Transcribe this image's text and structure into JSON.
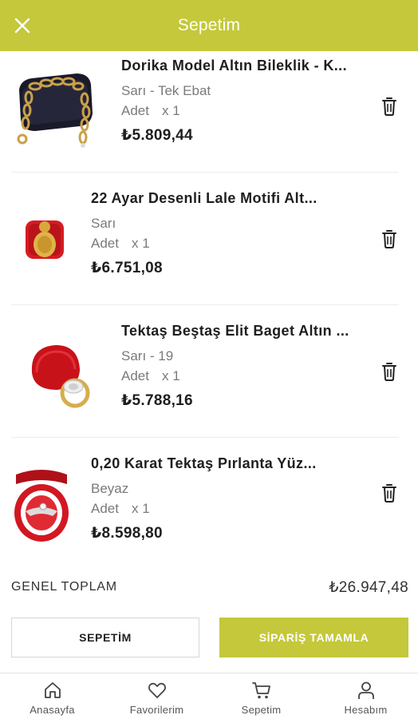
{
  "header": {
    "title": "Sepetim",
    "close_icon": "close-icon"
  },
  "items": [
    {
      "name": "Dorika Model Altın Bileklik - K...",
      "variant": "Sarı - Tek Ebat",
      "qty_label": "Adet",
      "qty": "x 1",
      "price": "₺5.809,44"
    },
    {
      "name": "22 Ayar Desenli Lale Motifi Alt...",
      "variant": "Sarı",
      "qty_label": "Adet",
      "qty": "x 1",
      "price": "₺6.751,08"
    },
    {
      "name": "Tektaş Beştaş Elit Baget Altın ...",
      "variant": "Sarı - 19",
      "qty_label": "Adet",
      "qty": "x 1",
      "price": "₺5.788,16"
    },
    {
      "name": "0,20 Karat Tektaş Pırlanta Yüz...",
      "variant": "Beyaz",
      "qty_label": "Adet",
      "qty": "x 1",
      "price": "₺8.598,80"
    }
  ],
  "summary": {
    "total_label": "GENEL TOPLAM",
    "total_value": "₺26.947,48"
  },
  "actions": {
    "cart_label": "SEPETİM",
    "checkout_label": "SİPARİŞ TAMAMLA"
  },
  "tabs": [
    {
      "label": "Anasayfa",
      "icon": "home-icon"
    },
    {
      "label": "Favorilerim",
      "icon": "heart-icon"
    },
    {
      "label": "Sepetim",
      "icon": "cart-icon"
    },
    {
      "label": "Hesabım",
      "icon": "user-icon"
    }
  ],
  "colors": {
    "accent": "#c4c83a",
    "text": "#1e1e1e",
    "muted": "#7a7a7a"
  }
}
